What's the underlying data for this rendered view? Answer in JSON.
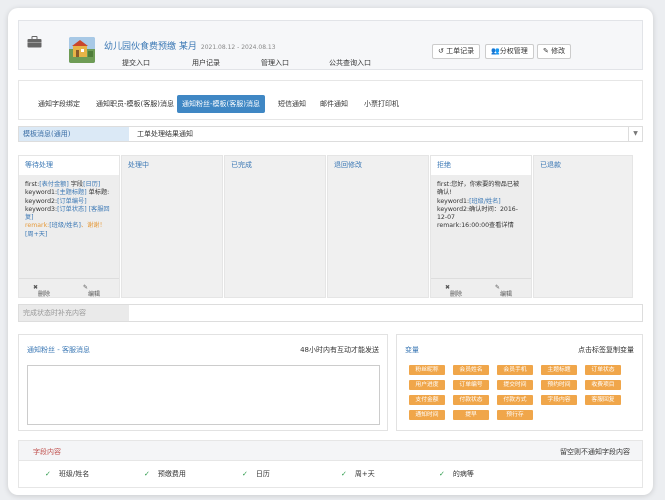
{
  "header": {
    "title": "幼儿园伙食费预缴 某月",
    "date_range": "2021.08.12 - 2024.08.13",
    "nav": [
      "提交入口",
      "用户记录",
      "管理入口",
      "公共查询入口"
    ],
    "buttons": [
      "工单记录",
      "分权管理",
      "修改"
    ]
  },
  "tabs": [
    "通知字段绑定",
    "通知职员-模板(客服)消息",
    "通知粉丝-模板(客服)消息",
    "短信通知",
    "邮件通知",
    "小票打印机"
  ],
  "template_row": {
    "label": "模板消息(通用)",
    "value": "工单处理结果通知"
  },
  "columns": [
    {
      "title": "等待处理",
      "lines": [
        [
          [
            "first:",
            "t"
          ],
          [
            "[表付金额]",
            "b"
          ],
          [
            " 字段",
            "t"
          ],
          [
            "[日历]",
            "b"
          ]
        ],
        [
          [
            "keyword1:",
            "t"
          ],
          [
            "[主题标题]",
            "b"
          ],
          [
            " 单标题:",
            "t"
          ]
        ],
        [
          [
            "keyword2:",
            "t"
          ],
          [
            "[订单编号]",
            "b"
          ]
        ],
        [
          [
            "keyword3:",
            "t"
          ],
          [
            "[订单状态]",
            "b"
          ],
          [
            " [客服回复]",
            "b"
          ]
        ],
        [
          [
            "remark:",
            "o"
          ],
          [
            "[班级/姓名]",
            "b"
          ],
          [
            "、谢谢！",
            "o"
          ],
          [
            "[周+天]",
            "b"
          ]
        ]
      ],
      "footer": [
        "删除",
        "编辑"
      ]
    },
    {
      "title": "处理中"
    },
    {
      "title": "已完成"
    },
    {
      "title": "退回修改"
    },
    {
      "title": "拒绝",
      "lines": [
        [
          [
            "first:您好，你索要的物品已被确认!",
            "t"
          ]
        ],
        [
          [
            "keyword1:",
            "t"
          ],
          [
            "[班级/姓名]",
            "b"
          ]
        ],
        [
          [
            "keyword2:确认时间：2016-12-07",
            "t"
          ]
        ],
        [
          [
            "remark:16:00:00查看详情",
            "t"
          ]
        ]
      ],
      "footer": [
        "删除",
        "编辑"
      ]
    },
    {
      "title": "已退款"
    }
  ],
  "supplement_row": {
    "label": "完成状态时补充内容"
  },
  "notify_panel": {
    "title": "通知粉丝 - 客服消息",
    "hint": "48小时内有互动才能发送"
  },
  "variables_panel": {
    "title": "变量",
    "hint": "点击标签复制变量",
    "tags": [
      "粉丝昵称",
      "会员姓名",
      "会员手机",
      "主题标题",
      "订单状态",
      "用户进度",
      "订单编号",
      "提交时间",
      "预约时间",
      "收费项目",
      "支付金额",
      "付款状态",
      "付款方式",
      "字段内容",
      "客服回复",
      "通知时间",
      "提早",
      "预行存"
    ]
  },
  "fields": {
    "title": "字段内容",
    "hint": "留空则不通知字段内容",
    "items": [
      "班级/姓名",
      "预缴费用",
      "日历",
      "周+天",
      "的病等"
    ]
  }
}
